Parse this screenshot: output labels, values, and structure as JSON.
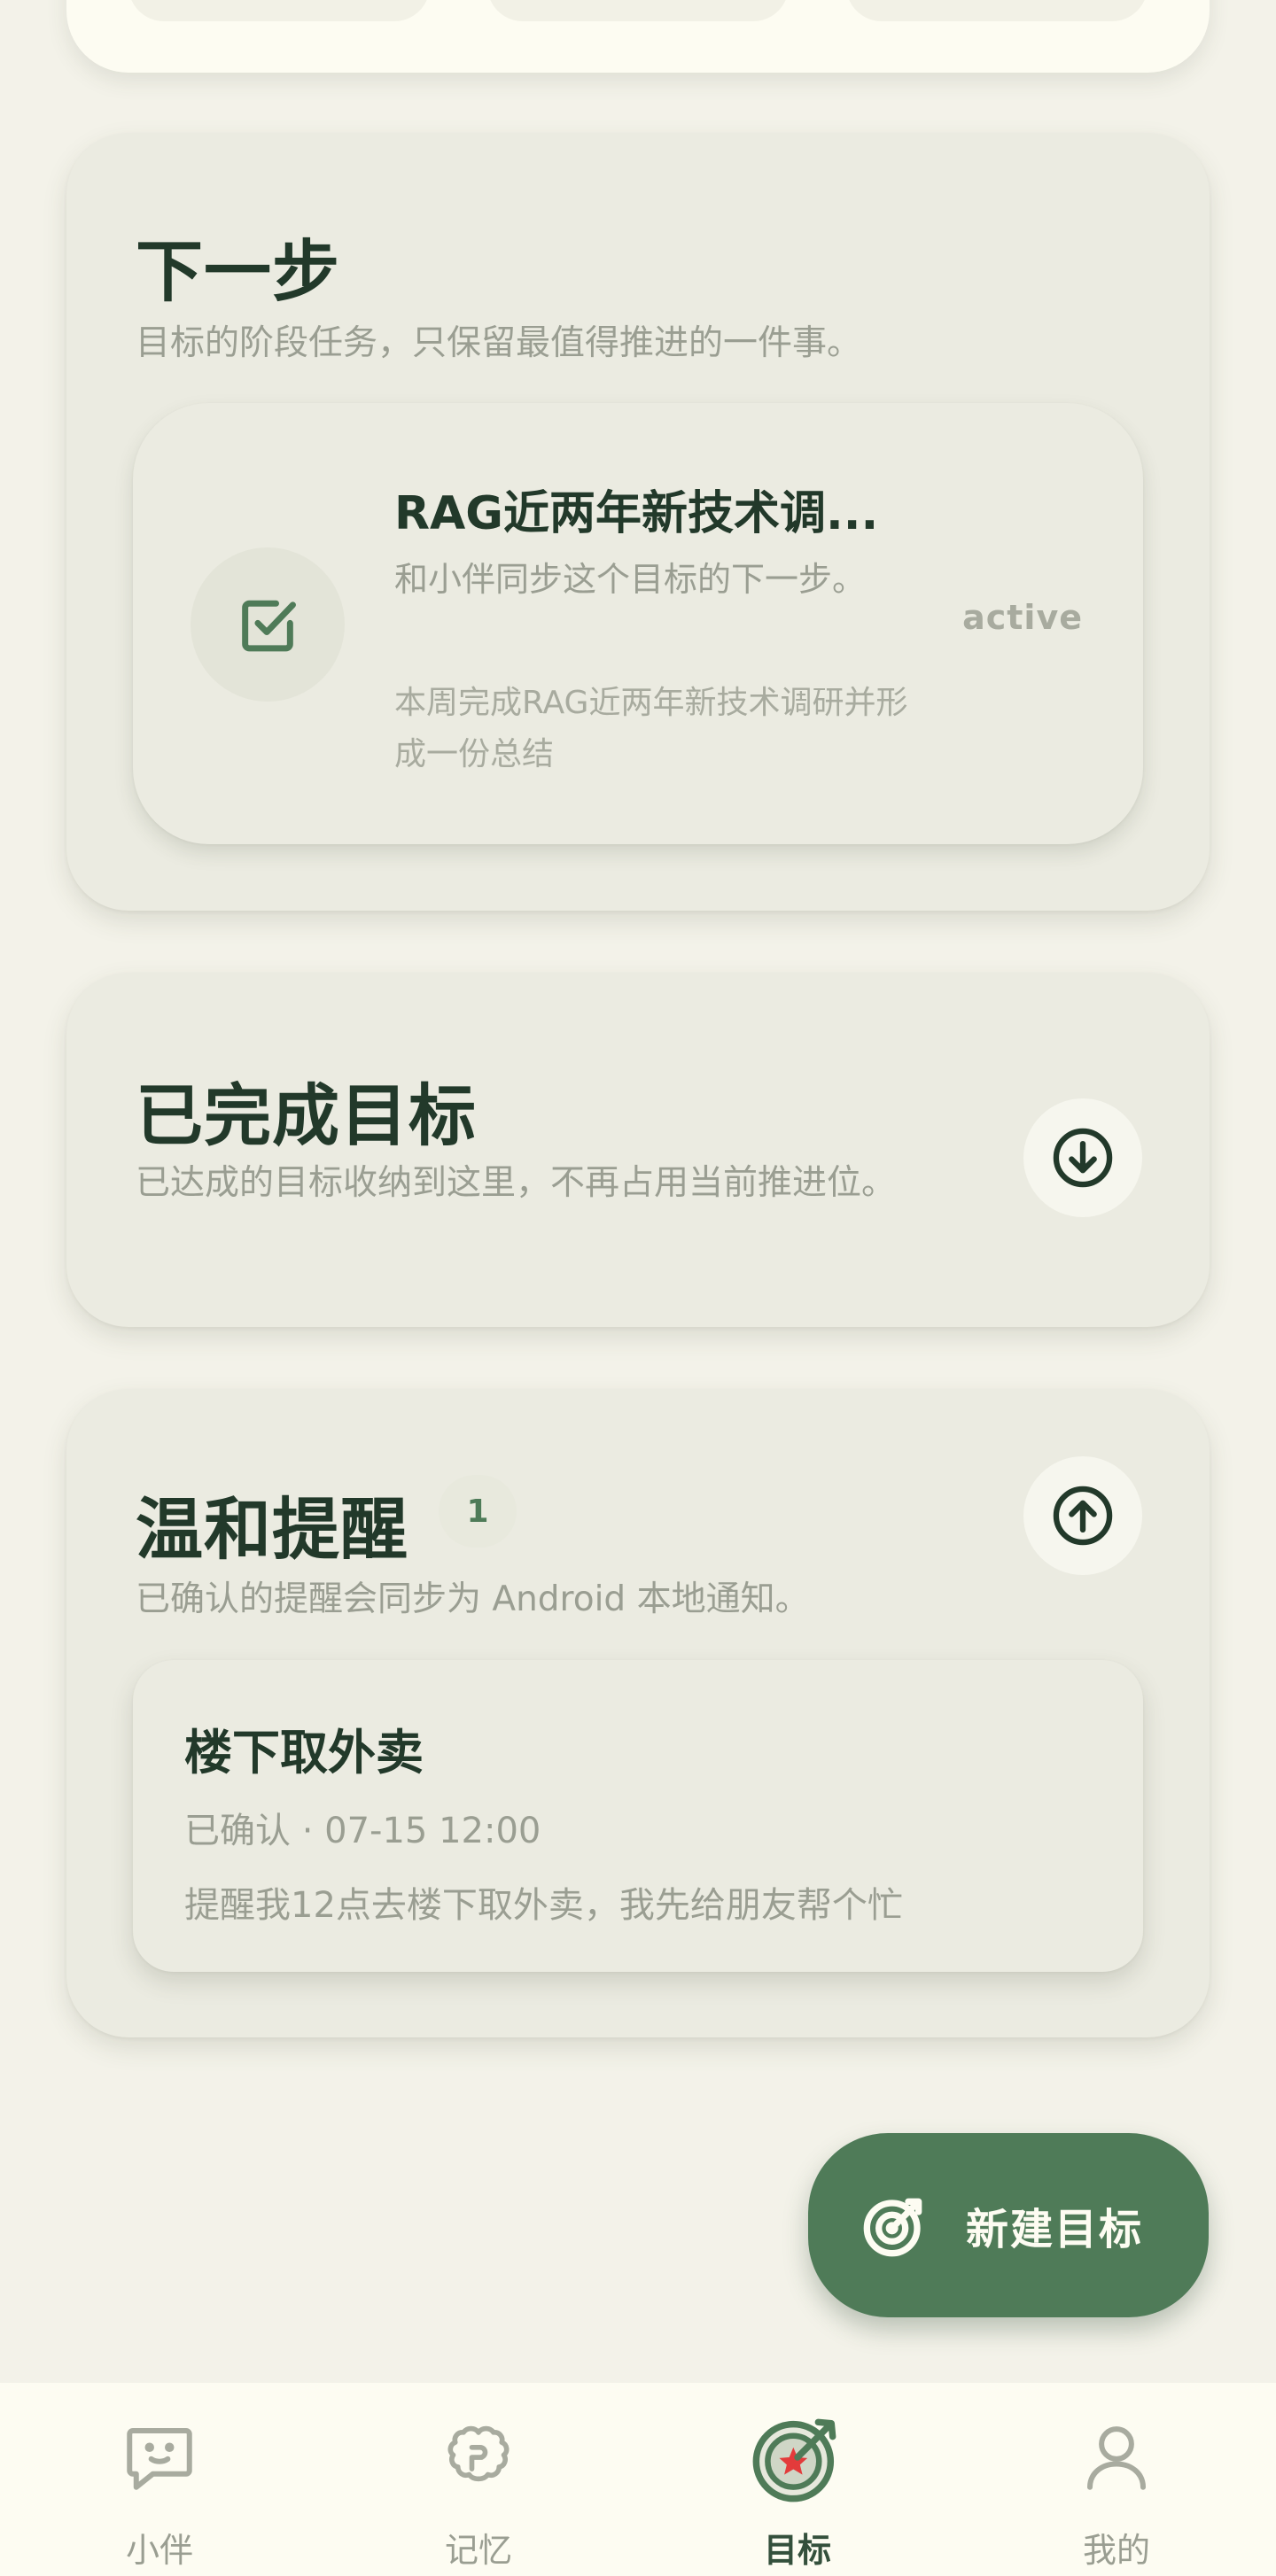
{
  "next_step": {
    "title": "下一步",
    "subtitle": "目标的阶段任务，只保留最值得推进的一件事。",
    "task": {
      "title": "RAG近两年新技术调...",
      "description": "和小伴同步这个目标的下一步。",
      "goal": "本周完成RAG近两年新技术调研并形成一份总结",
      "status": "active",
      "icon": "checkbox-icon"
    }
  },
  "completed": {
    "title": "已完成目标",
    "subtitle": "已达成的目标收纳到这里，不再占用当前推进位。",
    "toggle_icon": "chevron-down-circle-icon"
  },
  "reminders": {
    "title": "温和提醒",
    "count": "1",
    "subtitle": "已确认的提醒会同步为 Android 本地通知。",
    "toggle_icon": "chevron-up-circle-icon",
    "items": [
      {
        "title": "楼下取外卖",
        "meta": "已确认 · 07-15 12:00",
        "text": "提醒我12点去楼下取外卖，我先给朋友帮个忙"
      }
    ]
  },
  "fab": {
    "label": "新建目标",
    "icon": "target-icon"
  },
  "bottom_nav": {
    "items": [
      {
        "label": "小伴",
        "icon": "chat-bubble-icon",
        "active": false
      },
      {
        "label": "记忆",
        "icon": "brain-icon",
        "active": false
      },
      {
        "label": "目标",
        "icon": "target-icon",
        "active": true
      },
      {
        "label": "我的",
        "icon": "person-icon",
        "active": false
      }
    ]
  },
  "colors": {
    "background": "#f3f2e9",
    "card": "#ebebe1",
    "accent": "#4f7b58",
    "title": "#22392a",
    "muted": "#9a9e92",
    "target_center": "#e33b3b"
  }
}
